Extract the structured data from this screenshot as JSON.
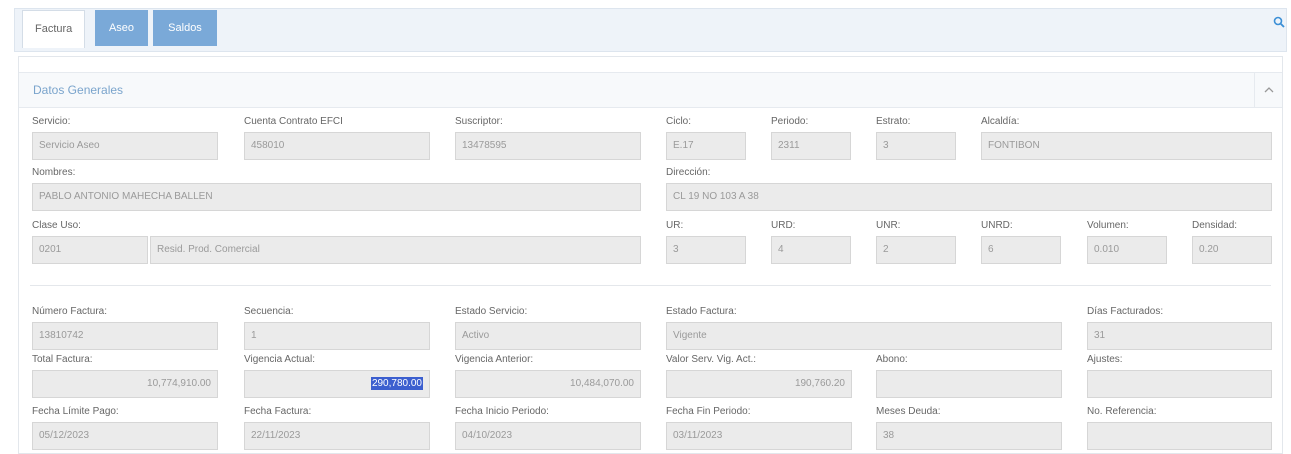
{
  "tabs": [
    {
      "label": "Factura"
    },
    {
      "label": "Aseo"
    },
    {
      "label": "Saldos"
    }
  ],
  "section": {
    "title": "Datos Generales"
  },
  "fields": {
    "servicio": {
      "label": "Servicio:",
      "value": "Servicio Aseo"
    },
    "cuenta": {
      "label": "Cuenta Contrato EFCI",
      "value": "458010"
    },
    "suscriptor": {
      "label": "Suscriptor:",
      "value": "13478595"
    },
    "ciclo": {
      "label": "Ciclo:",
      "value": "E.17"
    },
    "periodo": {
      "label": "Periodo:",
      "value": "2311"
    },
    "estrato": {
      "label": "Estrato:",
      "value": "3"
    },
    "alcaldia": {
      "label": "Alcaldía:",
      "value": "FONTIBON"
    },
    "nombres": {
      "label": "Nombres:",
      "value": "PABLO ANTONIO MAHECHA BALLEN"
    },
    "direccion": {
      "label": "Dirección:",
      "value": "CL 19 NO 103 A 38"
    },
    "clase_uso": {
      "label": "Clase Uso:",
      "code": "0201",
      "value": "Resid. Prod. Comercial"
    },
    "ur": {
      "label": "UR:",
      "value": "3"
    },
    "urd": {
      "label": "URD:",
      "value": "4"
    },
    "unr": {
      "label": "UNR:",
      "value": "2"
    },
    "unrd": {
      "label": "UNRD:",
      "value": "6"
    },
    "volumen": {
      "label": "Volumen:",
      "value": "0.010"
    },
    "densidad": {
      "label": "Densidad:",
      "value": "0.20"
    },
    "numero_factura": {
      "label": "Número Factura:",
      "value": "13810742"
    },
    "secuencia": {
      "label": "Secuencia:",
      "value": "1"
    },
    "estado_servicio": {
      "label": "Estado Servicio:",
      "value": "Activo"
    },
    "estado_factura": {
      "label": "Estado Factura:",
      "value": "Vigente"
    },
    "dias_facturados": {
      "label": "Días Facturados:",
      "value": "31"
    },
    "total_factura": {
      "label": "Total Factura:",
      "value": "10,774,910.00"
    },
    "vigencia_actual": {
      "label": "Vigencia Actual:",
      "value": "290,780.00"
    },
    "vigencia_anterior": {
      "label": "Vigencia Anterior:",
      "value": "10,484,070.00"
    },
    "valor_serv": {
      "label": "Valor Serv. Vig. Act.:",
      "value": "190,760.20"
    },
    "abono": {
      "label": "Abono:",
      "value": ""
    },
    "ajustes": {
      "label": "Ajustes:",
      "value": ""
    },
    "fecha_limite": {
      "label": "Fecha Límite Pago:",
      "value": "05/12/2023"
    },
    "fecha_factura": {
      "label": "Fecha Factura:",
      "value": "22/11/2023"
    },
    "fecha_inicio": {
      "label": "Fecha Inicio Periodo:",
      "value": "04/10/2023"
    },
    "fecha_fin": {
      "label": "Fecha Fin Periodo:",
      "value": "03/11/2023"
    },
    "meses_deuda": {
      "label": "Meses Deuda:",
      "value": "38"
    },
    "no_referencia": {
      "label": "No. Referencia:",
      "value": ""
    }
  }
}
